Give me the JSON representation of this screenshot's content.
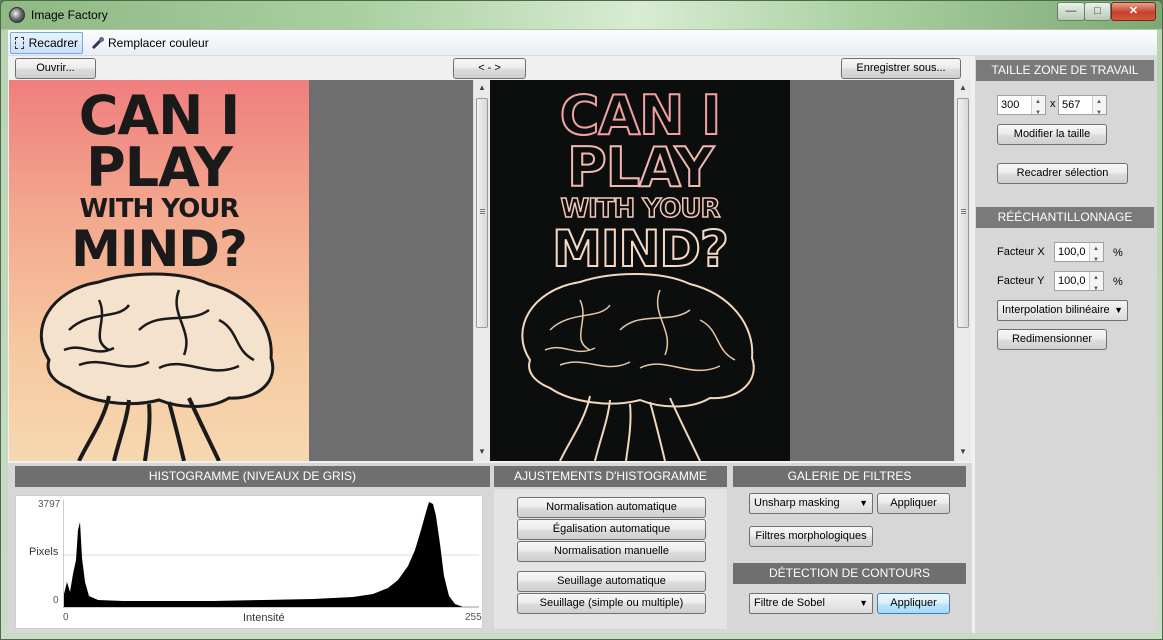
{
  "window": {
    "title": "Image Factory",
    "min_glyph": "—",
    "max_glyph": "□",
    "close_glyph": "✕"
  },
  "toolbar": {
    "crop_label": "Recadrer",
    "replace_color_label": "Remplacer couleur"
  },
  "actions": {
    "open_label": "Ouvrir...",
    "swap_label": "< - >",
    "save_as_label": "Enregistrer sous..."
  },
  "poster": {
    "line1": "CAN I",
    "line2": "PLAY",
    "line3": "WITH YOUR",
    "line4": "MIND?"
  },
  "histogram": {
    "header": "HISTOGRAMME  (NIVEAUX DE GRIS)",
    "y_max_label": "3797",
    "y_axis_label": "Pixels",
    "y_min_label": "0",
    "x_min_label": "0",
    "x_axis_label": "Intensité",
    "x_max_label": "255"
  },
  "adjustments": {
    "header": "AJUSTEMENTS D'HISTOGRAMME",
    "auto_normalization": "Normalisation automatique",
    "auto_equalization": "Égalisation automatique",
    "manual_normalization": "Normalisation manuelle",
    "auto_threshold": "Seuillage automatique",
    "threshold_multi": "Seuillage (simple ou multiple)"
  },
  "filters": {
    "header": "GALERIE DE FILTRES",
    "selected": "Unsharp masking",
    "apply_label": "Appliquer",
    "morph_label": "Filtres morphologiques"
  },
  "edges": {
    "header": "DÉTECTION DE CONTOURS",
    "selected": "Filtre de Sobel",
    "apply_label": "Appliquer"
  },
  "workspace": {
    "header": "TAILLE ZONE DE TRAVAIL",
    "width_value": "300",
    "times": "x",
    "height_value": "567",
    "resize_label": "Modifier la taille",
    "crop_selection_label": "Recadrer sélection"
  },
  "resampling": {
    "header": "RÉÉCHANTILLONNAGE",
    "factor_x_label": "Facteur X",
    "factor_x_value": "100,0",
    "factor_y_label": "Facteur Y",
    "factor_y_value": "100,0",
    "percent": "%",
    "interpolation": "Interpolation bilinéaire",
    "resize_button": "Redimensionner"
  }
}
